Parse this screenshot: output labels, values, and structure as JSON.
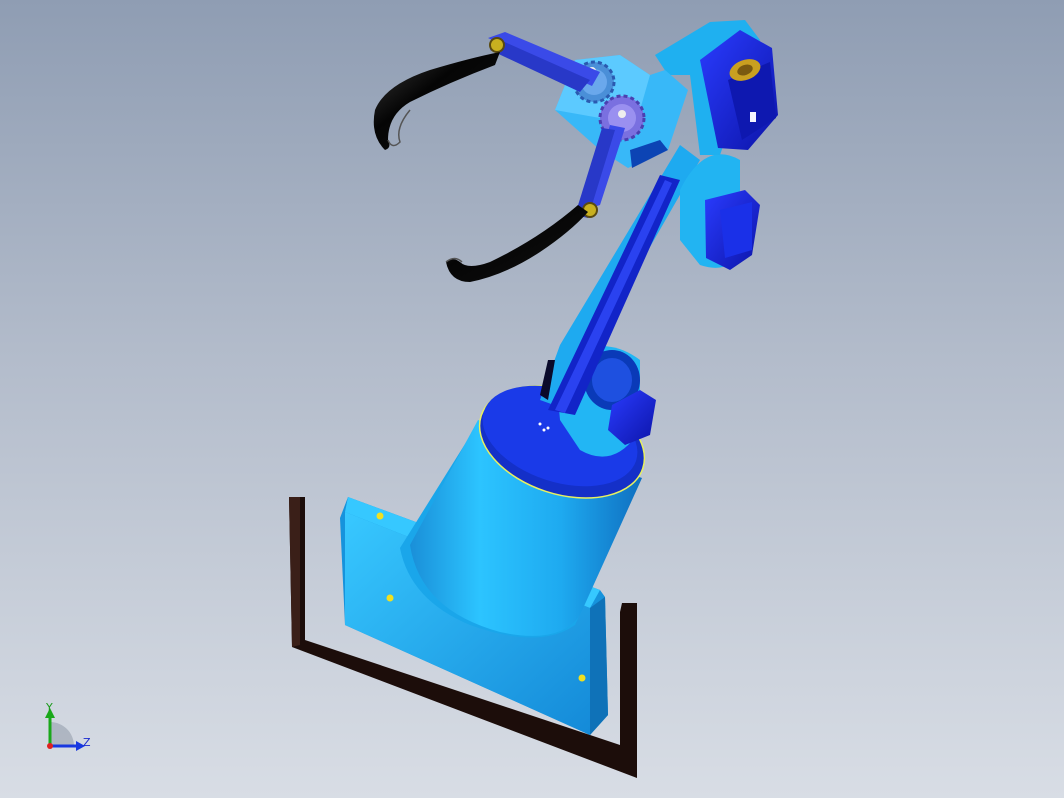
{
  "triad": {
    "y_label": "Y",
    "z_label": "Z"
  },
  "model": {
    "name_engraving": ""
  },
  "colors": {
    "light_part": "#1fb0f0",
    "dark_part": "#1826d8",
    "gripper_finger": "#0a0a0a",
    "base_plate": "#2a1410"
  }
}
